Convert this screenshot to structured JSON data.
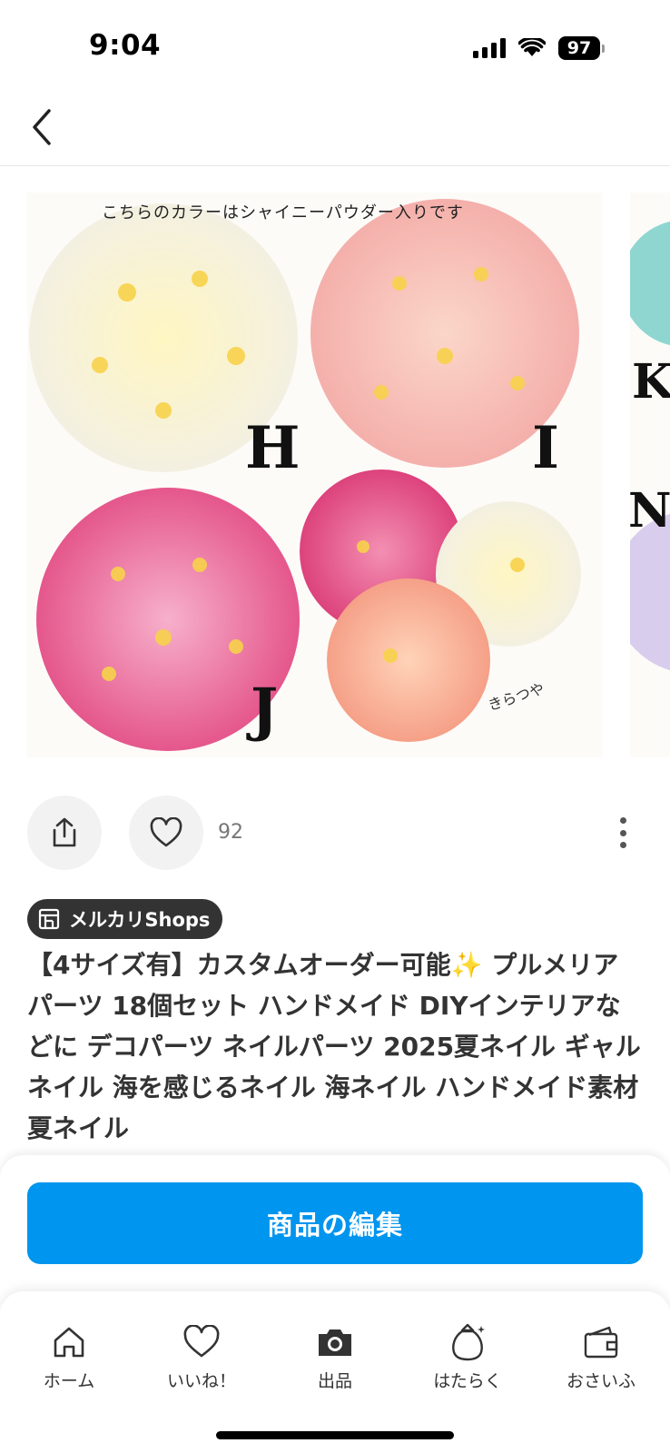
{
  "status_bar": {
    "time": "9:04",
    "battery": "97",
    "icons": [
      "cellular-signal-icon",
      "wifi-icon",
      "battery-icon"
    ]
  },
  "nav": {
    "back_icon": "chevron-left-icon"
  },
  "gallery": {
    "main_photo": {
      "caption": "こちらのカラーはシャイニーパウダー入りです",
      "letters": [
        "H",
        "I",
        "J"
      ],
      "signature": "きらつや"
    },
    "next_photo_letters": [
      "K",
      "N"
    ]
  },
  "actions": {
    "share_icon": "share-icon",
    "like_icon": "heart-icon",
    "like_count": "92",
    "more_icon": "more-vertical-icon"
  },
  "shop_badge": {
    "icon": "store-icon",
    "label": "メルカリShops"
  },
  "product": {
    "title": "【4サイズ有】カスタムオーダー可能✨ プルメリア パーツ 18個セット ハンドメイド DIYインテリアなどに デコパーツ ネイルパーツ 2025夏ネイル ギャルネイル 海を感じるネイル 海ネイル ハンドメイド素材 夏ネイル"
  },
  "edit_button": {
    "label": "商品の編集"
  },
  "tab_bar": {
    "items": [
      {
        "label": "ホーム",
        "icon": "home-icon"
      },
      {
        "label": "いいね！",
        "icon": "heart-icon"
      },
      {
        "label": "出品",
        "icon": "camera-icon"
      },
      {
        "label": "はたらく",
        "icon": "money-bag-icon"
      },
      {
        "label": "おさいふ",
        "icon": "wallet-icon"
      }
    ]
  },
  "colors": {
    "accent": "#0095ee",
    "badge_bg": "#333333",
    "text": "#333333"
  }
}
